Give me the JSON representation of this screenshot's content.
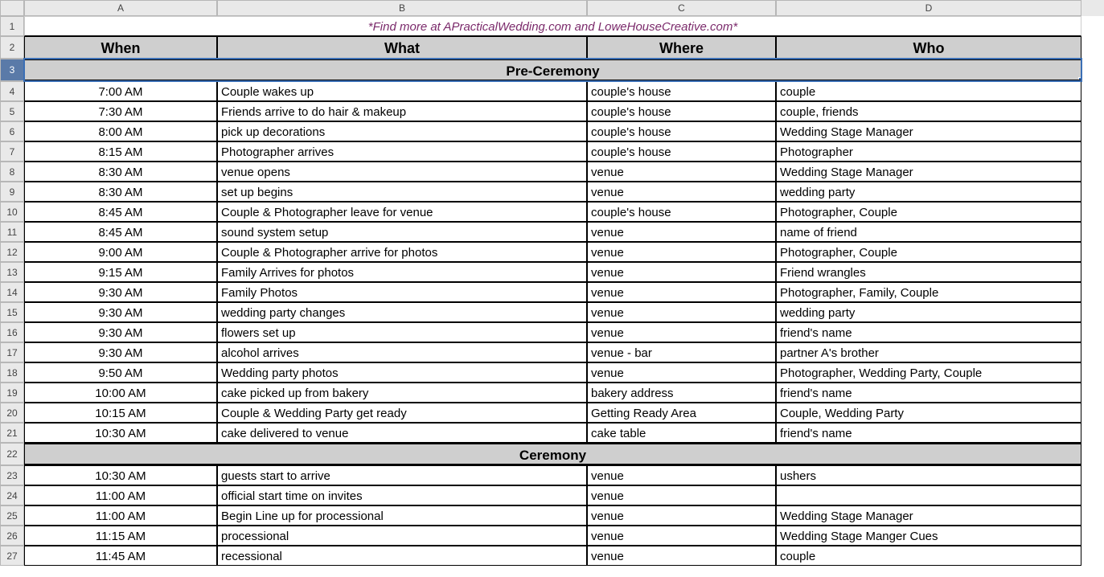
{
  "columns": [
    "A",
    "B",
    "C",
    "D"
  ],
  "title": "*Find more at APracticalWedding.com and LoweHouseCreative.com*",
  "headers": {
    "when": "When",
    "what": "What",
    "where": "Where",
    "who": "Who"
  },
  "sections": [
    {
      "name": "Pre-Ceremony",
      "rows": [
        {
          "when": "7:00 AM",
          "what": "Couple wakes up",
          "where": "couple's house",
          "who": "couple"
        },
        {
          "when": "7:30 AM",
          "what": "Friends arrive to do hair & makeup",
          "where": "couple's house",
          "who": "couple, friends"
        },
        {
          "when": "8:00 AM",
          "what": "pick up decorations",
          "where": "couple's house",
          "who": "Wedding Stage Manager"
        },
        {
          "when": "8:15 AM",
          "what": "Photographer arrives",
          "where": "couple's house",
          "who": "Photographer"
        },
        {
          "when": "8:30 AM",
          "what": "venue opens",
          "where": "venue",
          "who": "Wedding Stage Manager"
        },
        {
          "when": "8:30 AM",
          "what": "set up begins",
          "where": "venue",
          "who": "wedding party"
        },
        {
          "when": "8:45 AM",
          "what": "Couple & Photographer leave for venue",
          "where": "couple's house",
          "who": "Photographer, Couple"
        },
        {
          "when": "8:45 AM",
          "what": "sound system setup",
          "where": "venue",
          "who": "name of friend"
        },
        {
          "when": "9:00 AM",
          "what": "Couple & Photographer arrive for photos",
          "where": "venue",
          "who": "Photographer, Couple"
        },
        {
          "when": "9:15 AM",
          "what": "Family Arrives for photos",
          "where": "venue",
          "who": "Friend wrangles"
        },
        {
          "when": "9:30 AM",
          "what": "Family Photos",
          "where": "venue",
          "who": "Photographer, Family, Couple"
        },
        {
          "when": "9:30 AM",
          "what": "wedding party changes",
          "where": "venue",
          "who": "wedding party"
        },
        {
          "when": "9:30 AM",
          "what": "flowers set up",
          "where": "venue",
          "who": "friend's name"
        },
        {
          "when": "9:30 AM",
          "what": "alcohol arrives",
          "where": "venue - bar",
          "who": "partner A's brother"
        },
        {
          "when": "9:50 AM",
          "what": "Wedding party photos",
          "where": "venue",
          "who": "Photographer, Wedding Party, Couple"
        },
        {
          "when": "10:00 AM",
          "what": "cake picked up from bakery",
          "where": "bakery address",
          "who": "friend's name"
        },
        {
          "when": "10:15 AM",
          "what": "Couple & Wedding Party get ready",
          "where": "Getting Ready Area",
          "who": "Couple, Wedding Party"
        },
        {
          "when": "10:30 AM",
          "what": "cake delivered to venue",
          "where": "cake table",
          "who": "friend's name"
        }
      ]
    },
    {
      "name": "Ceremony",
      "rows": [
        {
          "when": "10:30 AM",
          "what": "guests start to arrive",
          "where": "venue",
          "who": "ushers"
        },
        {
          "when": "11:00 AM",
          "what": "official start time on invites",
          "where": "venue",
          "who": ""
        },
        {
          "when": "11:00 AM",
          "what": "Begin Line up for processional",
          "where": "venue",
          "who": "Wedding Stage Manager"
        },
        {
          "when": "11:15 AM",
          "what": "processional",
          "where": "venue",
          "who": "Wedding Stage Manger Cues"
        },
        {
          "when": "11:45 AM",
          "what": "recessional",
          "where": "venue",
          "who": "couple"
        }
      ]
    }
  ],
  "selected_row": 3
}
